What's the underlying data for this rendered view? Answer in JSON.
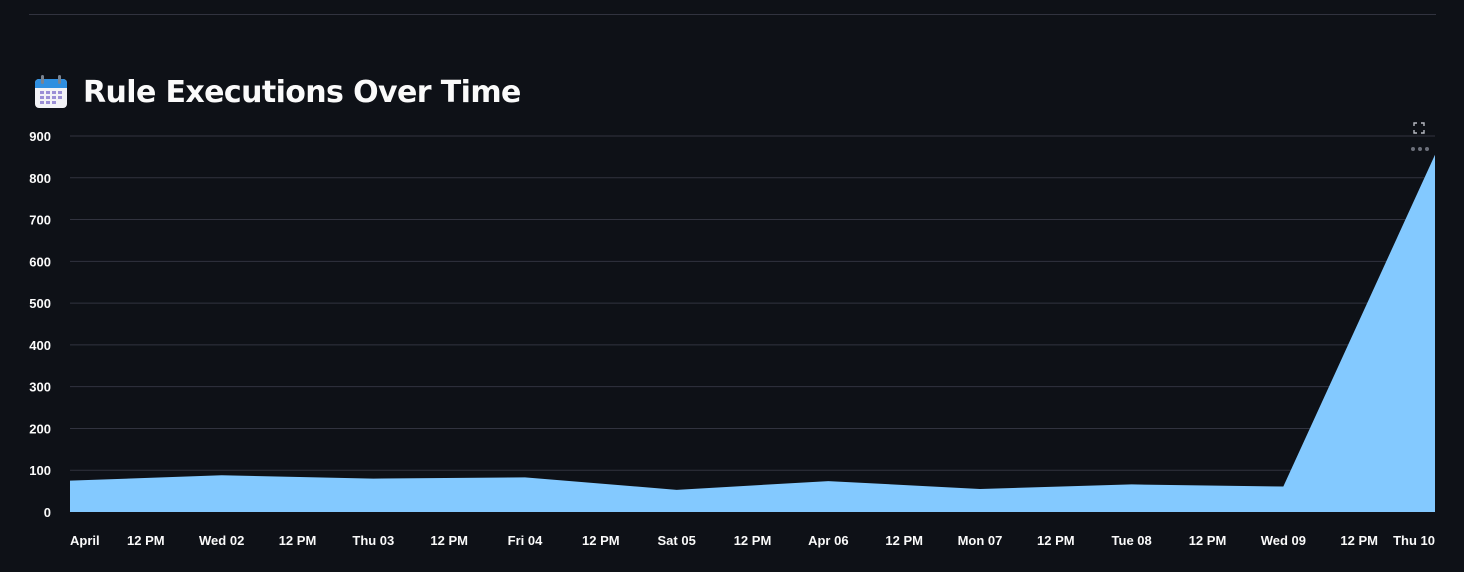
{
  "header": {
    "icon": "calendar-icon",
    "title": "Rule Executions Over Time"
  },
  "toolbar": {
    "fullscreen_icon": "expand-icon",
    "more_icon": "more-horizontal-icon"
  },
  "colors": {
    "background": "#0e1117",
    "area_fill": "#83c9ff",
    "gridline": "#31333f",
    "tick_text": "#fafafa"
  },
  "chart_data": {
    "type": "area",
    "title": "",
    "xlabel": "",
    "ylabel": "",
    "ylim": [
      0,
      900
    ],
    "yticks": [
      0,
      100,
      200,
      300,
      400,
      500,
      600,
      700,
      800,
      900
    ],
    "grid": true,
    "xlim": [
      "2025-04-01T00:00",
      "2025-04-10T00:00"
    ],
    "xticks": [
      {
        "at": "2025-04-01T00:00",
        "label": "April"
      },
      {
        "at": "2025-04-01T12:00",
        "label": "12 PM"
      },
      {
        "at": "2025-04-02T00:00",
        "label": "Wed 02"
      },
      {
        "at": "2025-04-02T12:00",
        "label": "12 PM"
      },
      {
        "at": "2025-04-03T00:00",
        "label": "Thu 03"
      },
      {
        "at": "2025-04-03T12:00",
        "label": "12 PM"
      },
      {
        "at": "2025-04-04T00:00",
        "label": "Fri 04"
      },
      {
        "at": "2025-04-04T12:00",
        "label": "12 PM"
      },
      {
        "at": "2025-04-05T00:00",
        "label": "Sat 05"
      },
      {
        "at": "2025-04-05T12:00",
        "label": "12 PM"
      },
      {
        "at": "2025-04-06T00:00",
        "label": "Apr 06"
      },
      {
        "at": "2025-04-06T12:00",
        "label": "12 PM"
      },
      {
        "at": "2025-04-07T00:00",
        "label": "Mon 07"
      },
      {
        "at": "2025-04-07T12:00",
        "label": "12 PM"
      },
      {
        "at": "2025-04-08T00:00",
        "label": "Tue 08"
      },
      {
        "at": "2025-04-08T12:00",
        "label": "12 PM"
      },
      {
        "at": "2025-04-09T00:00",
        "label": "Wed 09"
      },
      {
        "at": "2025-04-09T12:00",
        "label": "12 PM"
      },
      {
        "at": "2025-04-10T00:00",
        "label": "Thu 10"
      }
    ],
    "x": [
      "2025-04-01",
      "2025-04-02",
      "2025-04-03",
      "2025-04-04",
      "2025-04-05",
      "2025-04-06",
      "2025-04-07",
      "2025-04-08",
      "2025-04-09",
      "2025-04-10"
    ],
    "series": [
      {
        "values": [
          75,
          88,
          80,
          83,
          53,
          74,
          55,
          66,
          61,
          855
        ]
      }
    ]
  }
}
